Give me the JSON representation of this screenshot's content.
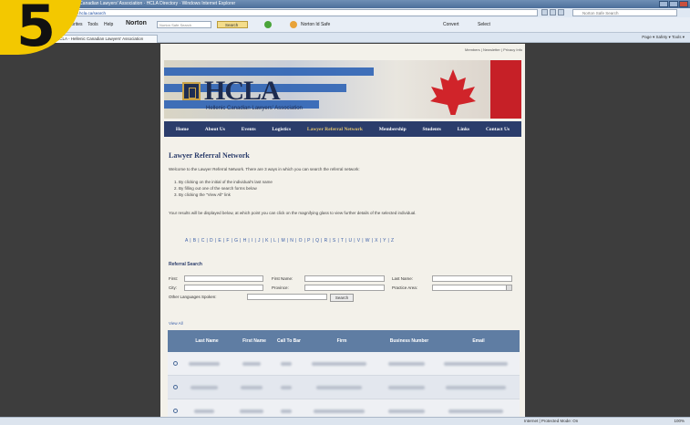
{
  "badge": {
    "number": "5"
  },
  "browser": {
    "title": "Hellenic Canadian Lawyers' Association · HCLA Directory · Windows Internet Explorer",
    "url": "http://www.hcla.ca/search",
    "search_placeholder": "Norton Safe Search",
    "toolbar": {
      "favorites": "Favorites",
      "tools": "Tools",
      "help": "Help",
      "norton": "Norton",
      "norton_search_placeholder": "Norton Safe Search",
      "search_btn": "Search",
      "identity": "Norton Id Safe",
      "convert": "Convert",
      "select": "Select"
    },
    "tab_title": "HCLA - Hellenic Canadian Lawyers' Association",
    "cmd": "Page ▾  Safety ▾  Tools ▾",
    "status_zone": "Internet | Protected Mode: On",
    "status_zoom": "100%"
  },
  "page": {
    "top_links": "Members  |  Newsletter  |  Privacy Info",
    "logo": "HCLA",
    "logo_sub": "Hellenic Canadian Lawyers' Association",
    "nav": [
      "Home",
      "About Us",
      "Events",
      "Logistics",
      "Lawyer Referral Network",
      "Membership",
      "Students",
      "Links",
      "Contact Us"
    ],
    "heading": "Lawyer Referral Network",
    "intro": "Welcome to the Lawyer Referral Network. There are 3 ways in which you can search the referral network:",
    "steps": [
      "By clicking on the initial of the individual's last name",
      "By filling out one of the search forms below",
      "By clicking the \"View All\" link"
    ],
    "results_note": "Your results will be displayed below, at which point you can click on the magnifying glass to view further details of the selected individual.",
    "alphabet": "A | B | C | D | E | F | G | H | I | J | K | L | M | N | O | P | Q | R | S | T | U | V | W | X | Y | Z",
    "search_title": "Referral Search",
    "labels": {
      "first": "First:",
      "first_name": "First Name:",
      "last_name": "Last Name:",
      "city": "City:",
      "province": "Province:",
      "practice_area": "Practice Area:",
      "other_lang": "Other Languages Spoken:"
    },
    "search_button": "Search",
    "view_all": "View All",
    "table_headers": [
      "Last Name",
      "First Name",
      "Call To Bar",
      "Firm",
      "Business Number",
      "Email"
    ]
  }
}
